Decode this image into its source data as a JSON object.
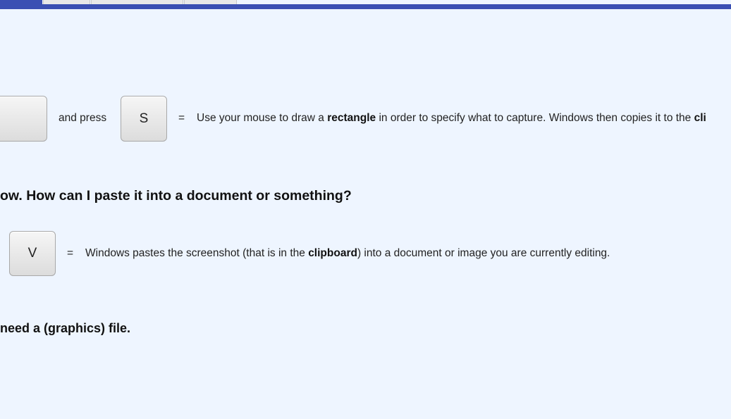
{
  "row1": {
    "and_press": "and press",
    "key": "S",
    "equals": "=",
    "desc_1": "Use your mouse to draw a ",
    "desc_bold_1": "rectangle",
    "desc_2": " in order to specify what to capture. Windows then copies it to the ",
    "desc_bold_2": "cli"
  },
  "heading1": "ow. How can I paste it into a document or something?",
  "row2": {
    "key": "V",
    "equals": "=",
    "desc_1": "Windows pastes the screenshot (that is in the ",
    "desc_bold": "clipboard",
    "desc_2": ") into a document or image you are currently editing."
  },
  "heading2": "need a (graphics) file."
}
